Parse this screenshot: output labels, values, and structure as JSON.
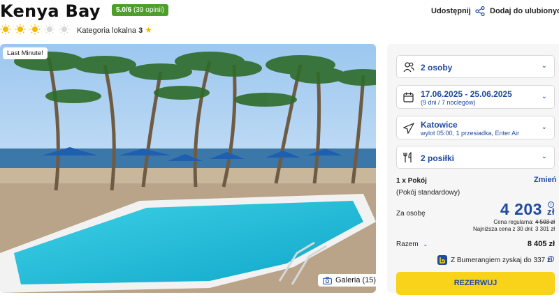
{
  "hotel": {
    "name": "Kenya Bay",
    "rating_score": "5.0/6",
    "rating_count": "(39 opinii)",
    "suns_filled": 3,
    "suns_total": 5,
    "category_label": "Kategoria lokalna",
    "category_value": "3"
  },
  "actions": {
    "share_label": "Udostępnij",
    "favorite_label": "Dodaj do ulubionych"
  },
  "photo": {
    "badge": "Last Minute!",
    "gallery_label": "Galeria (15)"
  },
  "booking": {
    "guests": "2 osoby",
    "dates": "17.06.2025 - 25.06.2025",
    "dates_sub": "(9 dni / 7 noclegów)",
    "departure": "Katowice",
    "departure_sub": "wylot 05:00, 1 przesiadka, Enter Air",
    "meals": "2 posiłki",
    "room_count": "1 x Pokój",
    "room_change": "Zmień",
    "room_type": "(Pokój standardowy)",
    "per_person_label": "Za osobę",
    "price": "4 203",
    "currency": "zł",
    "regular_label": "Cena regularna:",
    "regular_price": "4 503 zł",
    "lowest_label": "Najniższa cena z 30 dni:",
    "lowest_price": "3 301 zł",
    "total_label": "Razem",
    "total_value": "8 405 zł",
    "bonus_text": "Z Bumerangiem zyskaj do 337 zł",
    "reserve_button": "REZERWUJ"
  },
  "colors": {
    "brand_blue": "#1f4aa0",
    "rating_green": "#4d9e2b",
    "cta_yellow": "#f9d21a",
    "sun": "#f5b800"
  }
}
